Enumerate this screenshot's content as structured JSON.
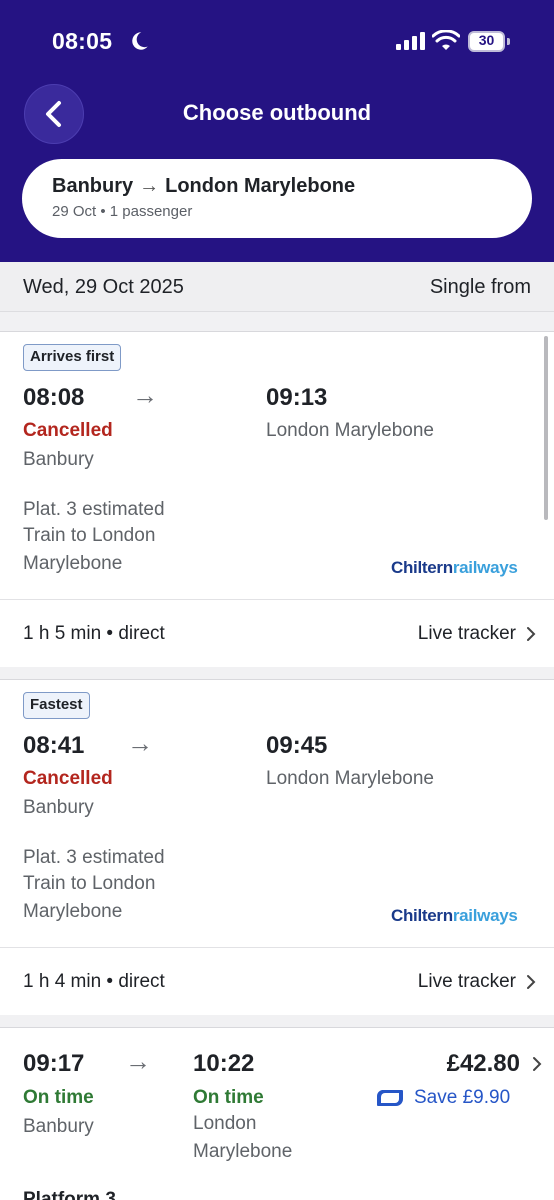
{
  "status_bar": {
    "time": "08:05",
    "battery": "30"
  },
  "header": {
    "title": "Choose outbound"
  },
  "journey": {
    "origin": "Banbury",
    "arrow": "→",
    "destination": "London Marylebone",
    "subtitle": "29 Oct • 1 passenger"
  },
  "date_bar": {
    "date": "Wed, 29 Oct 2025",
    "price_label": "Single from"
  },
  "icons": {
    "back": "chevron-left-icon",
    "moon": "moon-icon",
    "signal": "cellular-signal-icon",
    "wifi": "wifi-icon",
    "battery": "battery-icon",
    "chevron": "chevron-right-icon",
    "railcard": "railcard-icon"
  },
  "colors": {
    "header_bg": "#251383",
    "cancelled": "#b3261e",
    "on_time": "#2f7a35",
    "save": "#2656c7"
  },
  "trains": [
    {
      "badge": "Arrives first",
      "depart": "08:08",
      "arrow": "→",
      "arrive": "09:13",
      "status": "Cancelled",
      "origin": "Banbury",
      "destination": "London Marylebone",
      "platform": "Plat. 3 estimated",
      "service_line1": "Train to London",
      "service_line2": "Marylebone",
      "operator_a": "Chiltern",
      "operator_b": "railways",
      "duration": "1 h 5 min • direct",
      "tracker": "Live tracker"
    },
    {
      "badge": "Fastest",
      "depart": "08:41",
      "arrow": "→",
      "arrive": "09:45",
      "status": "Cancelled",
      "origin": "Banbury",
      "destination": "London Marylebone",
      "platform": "Plat. 3 estimated",
      "service_line1": "Train to London",
      "service_line2": "Marylebone",
      "operator_a": "Chiltern",
      "operator_b": "railways",
      "duration": "1 h 4 min • direct",
      "tracker": "Live tracker"
    },
    {
      "depart": "09:17",
      "arrow": "→",
      "arrive": "10:22",
      "depart_status": "On time",
      "arrive_status": "On time",
      "origin": "Banbury",
      "destination_line1": "London",
      "destination_line2": "Marylebone",
      "price": "£42.80",
      "save": "Save £9.90",
      "platform": "Platform 3"
    }
  ]
}
